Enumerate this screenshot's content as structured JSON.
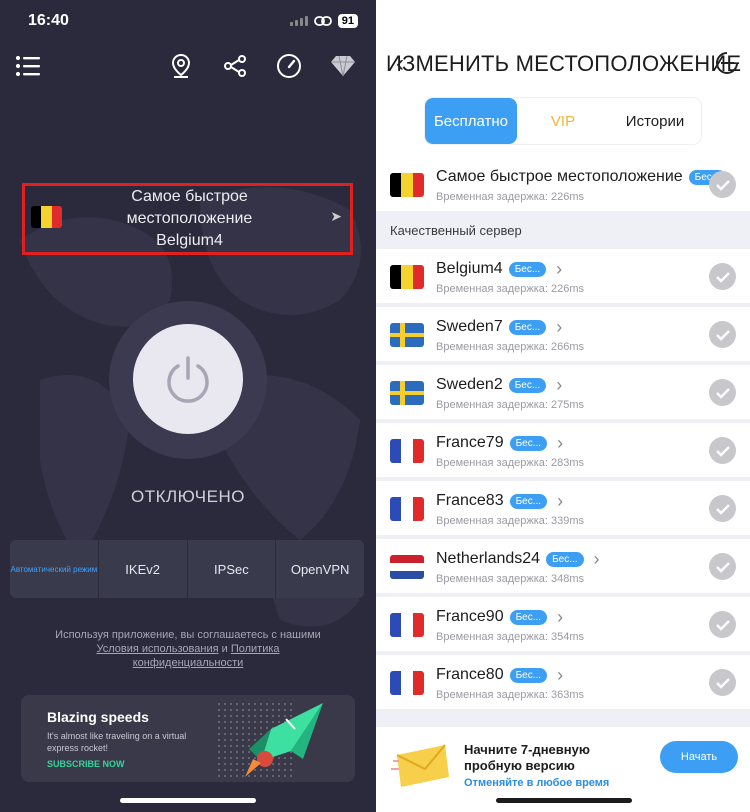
{
  "left": {
    "status_time": "16:40",
    "battery": "91",
    "location": {
      "line1": "Самое быстрое местоположение",
      "line2": "Belgium4",
      "flag": [
        "#000000",
        "#f5d22e",
        "#e12b2b"
      ]
    },
    "connection_status": "ОТКЛЮЧЕНО",
    "protocols": [
      "Автоматический режим",
      "IKEv2",
      "IPSec",
      "OpenVPN"
    ],
    "active_protocol_index": 0,
    "terms": {
      "prefix": "Используя приложение, вы соглашаетесь с нашими ",
      "link1": "Условия использования",
      "mid": " и ",
      "link2": "Политика конфиденциальности"
    },
    "promo": {
      "title": "Blazing speeds",
      "subtitle": "It's almost like traveling on a virtual express rocket!",
      "cta": "SUBSCRIBE NOW"
    }
  },
  "right": {
    "title": "ИЗМЕНИТЬ МЕСТОПОЛОЖЕНИЕ",
    "tabs": [
      "Бесплатно",
      "VIP",
      "Истории"
    ],
    "active_tab": 0,
    "fastest": {
      "name": "Самое быстрое местоположение",
      "badge": "Бес...",
      "latency": "Временная задержка: 226ms"
    },
    "section_label": "Качественный сервер",
    "servers": [
      {
        "name": "Belgium4",
        "badge": "Бес...",
        "latency": "Временная задержка: 226ms",
        "flag": "be"
      },
      {
        "name": "Sweden7",
        "badge": "Бес...",
        "latency": "Временная задержка: 266ms",
        "flag": "se"
      },
      {
        "name": "Sweden2",
        "badge": "Бес...",
        "latency": "Временная задержка: 275ms",
        "flag": "se"
      },
      {
        "name": "France79",
        "badge": "Бес...",
        "latency": "Временная задержка: 283ms",
        "flag": "fr"
      },
      {
        "name": "France83",
        "badge": "Бес...",
        "latency": "Временная задержка: 339ms",
        "flag": "fr"
      },
      {
        "name": "Netherlands24",
        "badge": "Бес...",
        "latency": "Временная задержка: 348ms",
        "flag": "nl"
      },
      {
        "name": "France90",
        "badge": "Бес...",
        "latency": "Временная задержка: 354ms",
        "flag": "fr"
      },
      {
        "name": "France80",
        "badge": "Бес...",
        "latency": "Временная задержка: 363ms",
        "flag": "fr"
      }
    ],
    "banner": {
      "title": "Начните 7-дневную пробную версию",
      "subtitle": "Отменяйте в любое время",
      "button": "Начать"
    }
  },
  "colors": {
    "accent": "#3d9ff3",
    "highlight_box": "#e0201e",
    "left_bg": "#2b2a3d",
    "vip": "#f4b43b",
    "promo_green": "#33d49a"
  },
  "icons": [
    "menu-icon",
    "location-pin-icon",
    "share-icon",
    "speedometer-icon",
    "diamond-icon",
    "power-icon",
    "back-icon",
    "close-icon",
    "check-icon",
    "envelope-icon",
    "rocket-icon"
  ]
}
